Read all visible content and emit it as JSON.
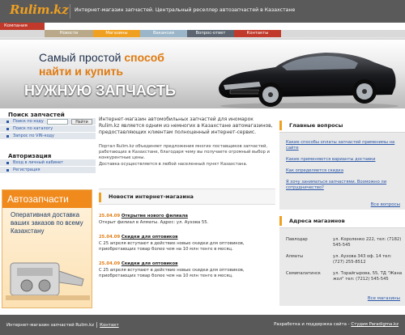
{
  "header": {
    "logo": "Rulim.kz",
    "tagline": "Интернет-магазин запчастей. Центральный реселлер автозапчастей в Казахстане"
  },
  "nav": {
    "company": "Компания",
    "items": [
      {
        "label": "Новости",
        "color": "#b9a98a"
      },
      {
        "label": "Магазины",
        "color": "#f0a020"
      },
      {
        "label": "Вакансии",
        "color": "#9bb6c9"
      },
      {
        "label": "Вопрос-ответ",
        "color": "#5c6570"
      },
      {
        "label": "Контакты",
        "color": "#c0392b"
      }
    ]
  },
  "banner": {
    "line1_a": "Самый простой ",
    "line1_b": "способ",
    "line2": "найти и купить",
    "line3": "НУЖНУЮ ЗАПЧАСТЬ"
  },
  "left": {
    "search_title": "Поиск запчастей",
    "search_items": [
      "Поиск по коду",
      "Поиск по каталогу",
      "Запрос по VIN-коду"
    ],
    "find_button": "Найти",
    "auth_title": "Авторизация",
    "auth_items": [
      "Вход в личный кабинет",
      "Регистрация"
    ],
    "ad_title": "Автозапчасти",
    "ad_text": "Оперативная доставка ваших заказов по всему Казахстану"
  },
  "center": {
    "intro": "Интернет-магазин автомобильных запчастей для иномарок Rulim.kz является одним из немногих в Казахстане автомагазинов, предоставляющих клиентам полноценный интернет-сервис.",
    "intro2": "Портал Rulim.kz объединяет предложения многих поставщиков запчастей, работающих в Казахстане, благодаря чему вы получаете огромный выбор и конкурентные цены.",
    "intro3": "Доставка осуществляется в любой населенный пункт Казахстана.",
    "news_title": "Новости интернет-магазина",
    "news": [
      {
        "date": "25.04.09",
        "head": "Открытие нового филиала",
        "text": "Открыт филиал в Алматы. Адрес: ул. Аухова 55."
      },
      {
        "date": "25.04.09",
        "head": "Скидки для оптовиков",
        "text": "С 25 апреля вступают в действие новые скидки для оптовиков, приобретающих товар более чем на 10 млн тенге в месяц."
      },
      {
        "date": "25.04.09",
        "head": "Скидки для оптовиков",
        "text": "С 25 апреля вступают в действие новые скидки для оптовиков, приобретающих товар более чем на 10 млн тенге в месяц."
      }
    ]
  },
  "right": {
    "faq_title": "Главные вопросы",
    "questions": [
      "Какие способы оплаты запчастей применимы на сайте",
      "Какие применяются варианты доставки",
      "Как определяется скидка",
      "Я хочу заниматься запчастями. Возможно ли сотрудничество?"
    ],
    "all_questions": "Все вопросы",
    "stores_title": "Адреса магазинов",
    "stores": [
      {
        "city": "Павлодар",
        "info": "ул. Короленко 222, тел: (7182) 545-545"
      },
      {
        "city": "Алматы",
        "info": "ул. Аухова 343 оф. 14 тел: (727) 255-8512"
      },
      {
        "city": "Семипалатинск",
        "info": "ул. Торайгырова, 55, ТД \"Жана жол\" тел: (7212) 545-545"
      }
    ],
    "all_stores": "Все магазины"
  },
  "footer": {
    "left": "Интернет-магазин запчастей Rulim.kz",
    "contacts": "Контакт",
    "right": "Разработка и поддержка сайта - ",
    "studio": "Студия Paradigma.kz"
  }
}
